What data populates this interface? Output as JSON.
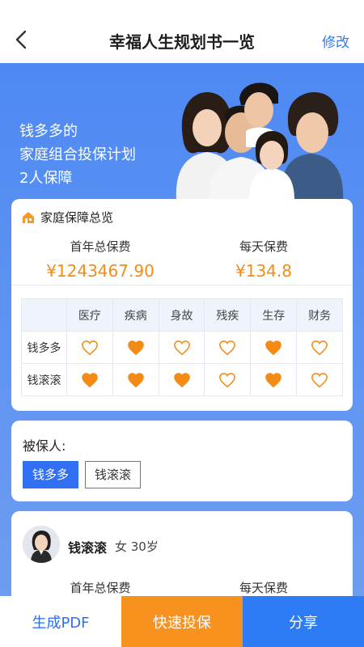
{
  "nav": {
    "title": "幸福人生规划书一览",
    "edit": "修改"
  },
  "hero": {
    "line1": "钱多多的",
    "line2": "家庭组合投保计划",
    "line3": "2人保障"
  },
  "overview": {
    "title": "家庭保障总览",
    "first_year_label": "首年总保费",
    "first_year_value": "¥1243467.90",
    "daily_label": "每天保费",
    "daily_value": "¥134.8",
    "columns": [
      "医疗",
      "疾病",
      "身故",
      "残疾",
      "生存",
      "财务"
    ],
    "rows": [
      {
        "name": "钱多多",
        "covered": [
          false,
          true,
          false,
          false,
          true,
          false
        ]
      },
      {
        "name": "钱滚滚",
        "covered": [
          true,
          true,
          true,
          false,
          true,
          false
        ]
      }
    ]
  },
  "insured": {
    "label": "被保人:",
    "options": [
      "钱多多",
      "钱滚滚"
    ],
    "selected": "钱多多"
  },
  "person": {
    "name": "钱滚滚",
    "meta": "女 30岁",
    "first_year_label": "首年总保费",
    "daily_label": "每天保费"
  },
  "actions": {
    "pdf": "生成PDF",
    "buy": "快速投保",
    "share": "分享"
  },
  "colors": {
    "primary": "#2f7bf6",
    "accent": "#f48b16",
    "hero_bg": "#5b92f2"
  }
}
